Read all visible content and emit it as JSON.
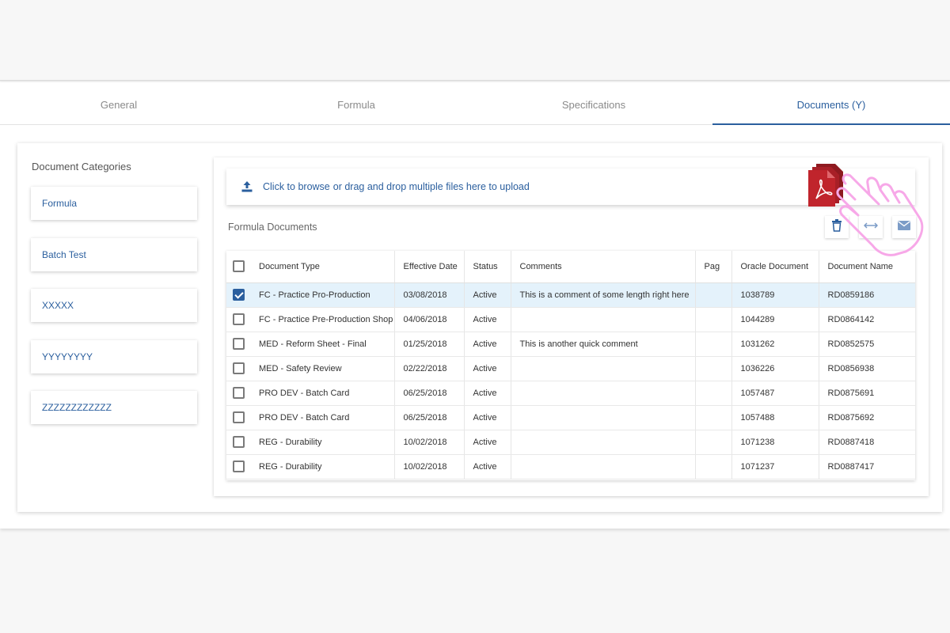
{
  "tabs": [
    {
      "label": "General",
      "active": false
    },
    {
      "label": "Formula",
      "active": false
    },
    {
      "label": "Specifications",
      "active": false
    },
    {
      "label": "Documents (Y)",
      "active": true
    }
  ],
  "categories": {
    "title": "Document Categories",
    "items": [
      "Formula",
      "Batch Test",
      "XXXXX",
      "YYYYYYYY",
      "ZZZZZZZZZZZZ"
    ]
  },
  "upload": {
    "link_text": "Click to browse",
    "rest_text": "or drag and drop multiple files here to upload"
  },
  "documents": {
    "title": "Formula Documents",
    "actions": [
      "trash-icon",
      "swap-icon",
      "mail-icon"
    ],
    "columns": [
      "Document Type",
      "Effective Date",
      "Status",
      "Comments",
      "Pag",
      "Oracle Document",
      "Document Name"
    ],
    "rows": [
      {
        "checked": true,
        "type": "FC - Practice Pro-Production",
        "date": "03/08/2018",
        "status": "Active",
        "comments": "This is a comment of some length right here",
        "pag": "",
        "oracle": "1038789",
        "name": "RD0859186"
      },
      {
        "checked": false,
        "type": "FC - Practice Pre-Production Shop",
        "date": "04/06/2018",
        "status": "Active",
        "comments": "",
        "pag": "",
        "oracle": "1044289",
        "name": "RD0864142"
      },
      {
        "checked": false,
        "type": "MED - Reform Sheet - Final",
        "date": "01/25/2018",
        "status": "Active",
        "comments": "This is another quick comment",
        "pag": "",
        "oracle": "1031262",
        "name": "RD0852575"
      },
      {
        "checked": false,
        "type": "MED - Safety Review",
        "date": "02/22/2018",
        "status": "Active",
        "comments": "",
        "pag": "",
        "oracle": "1036226",
        "name": "RD0856938"
      },
      {
        "checked": false,
        "type": "PRO DEV - Batch Card",
        "date": "06/25/2018",
        "status": "Active",
        "comments": "",
        "pag": "",
        "oracle": "1057487",
        "name": "RD0875691"
      },
      {
        "checked": false,
        "type": "PRO DEV - Batch Card",
        "date": "06/25/2018",
        "status": "Active",
        "comments": "",
        "pag": "",
        "oracle": "1057488",
        "name": "RD0875692"
      },
      {
        "checked": false,
        "type": "REG - Durability",
        "date": "10/02/2018",
        "status": "Active",
        "comments": "",
        "pag": "",
        "oracle": "1071238",
        "name": "RD0887418"
      },
      {
        "checked": false,
        "type": "REG - Durability",
        "date": "10/02/2018",
        "status": "Active",
        "comments": "",
        "pag": "",
        "oracle": "1071237",
        "name": "RD0887417"
      }
    ]
  },
  "colors": {
    "accent": "#2b5f9e",
    "selected_row": "#e4f2fb",
    "pdf_red": "#c0242c",
    "cursor_pink": "#f7a8e8"
  }
}
